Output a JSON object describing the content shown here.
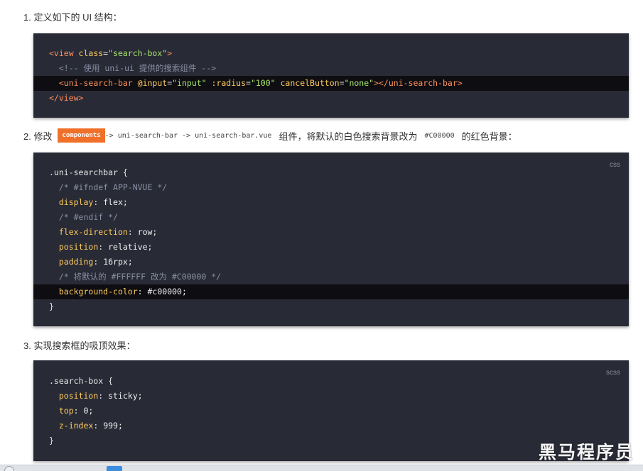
{
  "step1": {
    "text": "1. 定义如下的 UI 结构："
  },
  "code1": {
    "lang": "",
    "lines": [
      {
        "tag_open": "<view ",
        "attr": "class",
        "eq": "=",
        "str": "\"search-box\"",
        "close": ">"
      },
      {
        "comment": "<!-- 使用 uni-ui 提供的搜索组件 -->"
      },
      {
        "tag_open": "<uni-search-bar ",
        "a1": "@input",
        "s1": "\"input\"",
        "a2": ":radius",
        "s2": "\"100\"",
        "a3": "cancelButton",
        "s3": "\"none\"",
        "close": "></uni-search-bar>"
      },
      {
        "tag": "</view>"
      }
    ]
  },
  "step2": {
    "prefix": "2. 修改",
    "tag": "components",
    "path": "-> uni-search-bar -> uni-search-bar.vue",
    "middle": "组件，将默认的白色搜索背景改为",
    "hex": "#C00000",
    "suffix": "的红色背景："
  },
  "code2": {
    "lang": "css",
    "selector": ".uni-searchbar {",
    "c1": "/* #ifndef APP-NVUE */",
    "p1": "display",
    "v1": "flex;",
    "c2": "/* #endif */",
    "p2": "flex-direction",
    "v2": "row;",
    "p3": "position",
    "v3": "relative;",
    "p4": "padding",
    "v4": "16rpx;",
    "c3": "/* 将默认的 #FFFFFF 改为 #C00000 */",
    "p5": "background-color",
    "v5": "#c00000;",
    "close": "}"
  },
  "step3": {
    "text": "3. 实现搜索框的吸顶效果："
  },
  "code3": {
    "lang": "scss",
    "selector": ".search-box {",
    "p1": "position",
    "v1": "sticky;",
    "p2": "top",
    "v2": "0;",
    "p3": "z-index",
    "v3": "999;",
    "close": "}"
  },
  "watermark": "黑马程序员",
  "colors": {
    "code_bg": "#282a36",
    "highlight_bg": "#0e0e12",
    "tag": "#ff8f5a",
    "attr": "#ffcb5c",
    "string": "#a5e36b",
    "comment": "#8a8fa3",
    "orange_badge": "#f0702a"
  }
}
